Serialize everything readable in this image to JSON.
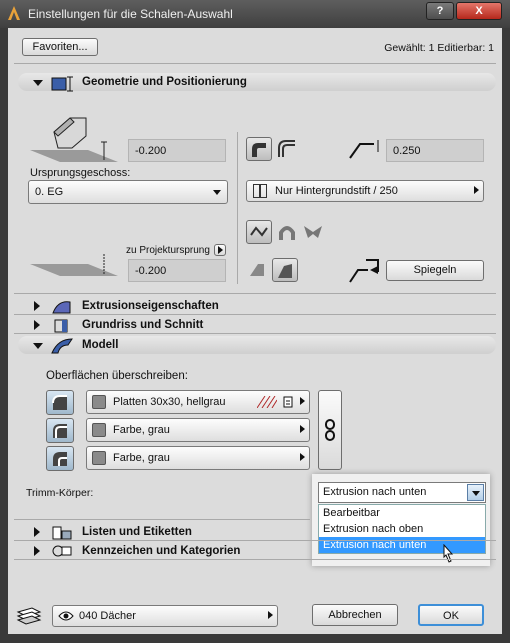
{
  "window": {
    "title": "Einstellungen für die Schalen-Auswahl",
    "help_glyph": "?",
    "close_glyph": "X"
  },
  "header": {
    "favorites_label": "Favoriten...",
    "selection_info": "Gewählt: 1 Editierbar: 1"
  },
  "sections": {
    "geometry": "Geometrie und Positionierung",
    "extrusion": "Extrusionseigenschaften",
    "floorplan": "Grundriss und Schnitt",
    "model": "Modell",
    "listing": "Listen und Etiketten",
    "tags": "Kennzeichen und Kategorien"
  },
  "geometry": {
    "thickness_value": "-0.200",
    "home_story_label": "Ursprungsgeschoss:",
    "home_story_value": "0. EG",
    "offset_label": "zu Projektursprung",
    "offset_value": "-0.200",
    "edge_value": "0.250",
    "contour_pen": "Nur Hintergrundstift / 250",
    "mirror_label": "Spiegeln"
  },
  "model": {
    "override_label": "Oberflächen überschreiben:",
    "surfaces": [
      "Platten 30x30, hellgrau",
      "Farbe, grau",
      "Farbe, grau"
    ]
  },
  "trim": {
    "label": "Trimm-Körper:",
    "selected": "Extrusion nach unten",
    "options": [
      "Bearbeitbar",
      "Extrusion nach oben",
      "Extrusion nach unten"
    ],
    "highlighted_index": 2
  },
  "footer": {
    "layer_value": "040 Dächer",
    "cancel_label": "Abbrechen",
    "ok_label": "OK"
  },
  "colors": {
    "accent": "#3399ff",
    "panel": "#dcdcdc",
    "title_bg": "#4a4a4a",
    "close_btn": "#c4372b"
  }
}
